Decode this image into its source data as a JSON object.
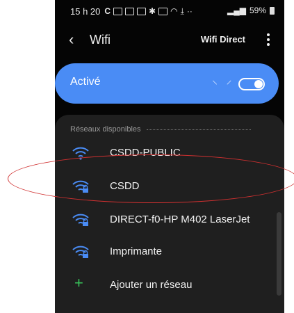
{
  "status_bar": {
    "time": "15 h 20",
    "battery": "59%"
  },
  "header": {
    "title": "Wifi",
    "wifi_direct_label": "Wifi Direct"
  },
  "toggle": {
    "label": "Activé",
    "state": "on"
  },
  "networks": {
    "section_header": "Réseaux disponibles",
    "items": [
      {
        "label": "CSDD-PUBLIC",
        "secured": false
      },
      {
        "label": "CSDD",
        "secured": true
      },
      {
        "label": "DIRECT-f0-HP M402 LaserJet",
        "secured": true
      },
      {
        "label": "Imprimante",
        "secured": true
      }
    ],
    "add_label": "Ajouter un réseau"
  },
  "colors": {
    "accent": "#4a8cf5",
    "add_icon": "#38c25a",
    "highlight": "#d03030"
  }
}
